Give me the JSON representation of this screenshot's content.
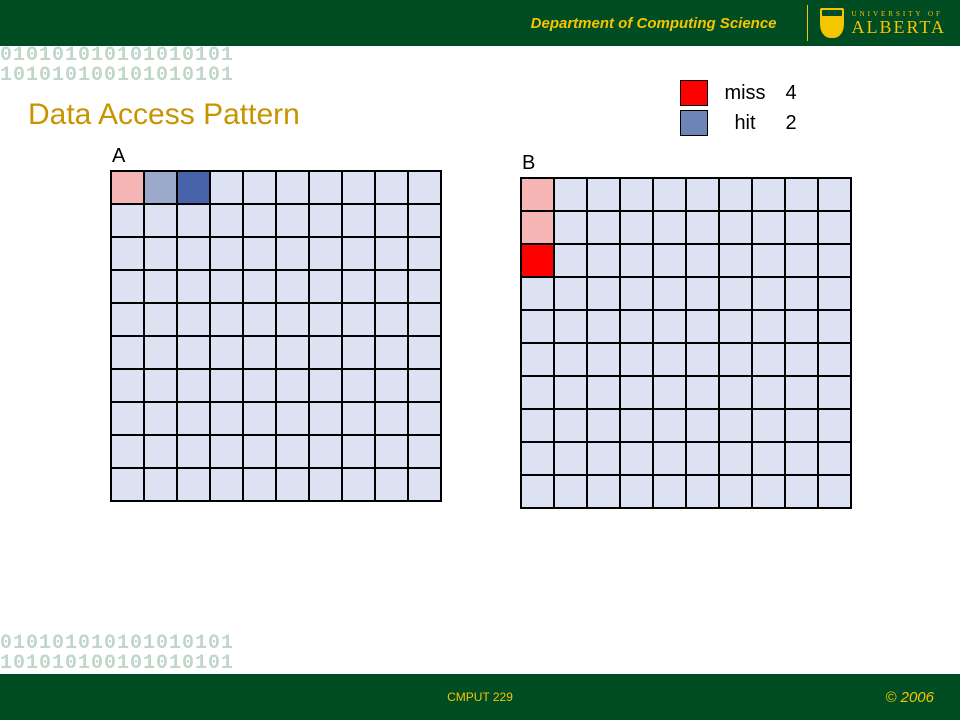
{
  "header": {
    "department": "Department of Computing Science",
    "university_top": "UNIVERSITY OF",
    "university_main": "ALBERTA"
  },
  "title": "Data Access Pattern",
  "legend": {
    "miss_label": "miss",
    "miss_count": "4",
    "hit_label": "hit",
    "hit_count": "2"
  },
  "grids": {
    "A": {
      "label": "A",
      "rows": 10,
      "cols": 10,
      "cells": {
        "0-0": "miss-faded",
        "0-1": "hit-faded",
        "0-2": "hit"
      }
    },
    "B": {
      "label": "B",
      "rows": 10,
      "cols": 10,
      "cells": {
        "0-0": "miss-faded",
        "1-0": "miss-faded",
        "2-0": "miss"
      }
    }
  },
  "footer": {
    "course": "CMPUT 229",
    "copyright": "© 2006"
  },
  "binary_lines": "010101010101010101\n101010100101010101"
}
